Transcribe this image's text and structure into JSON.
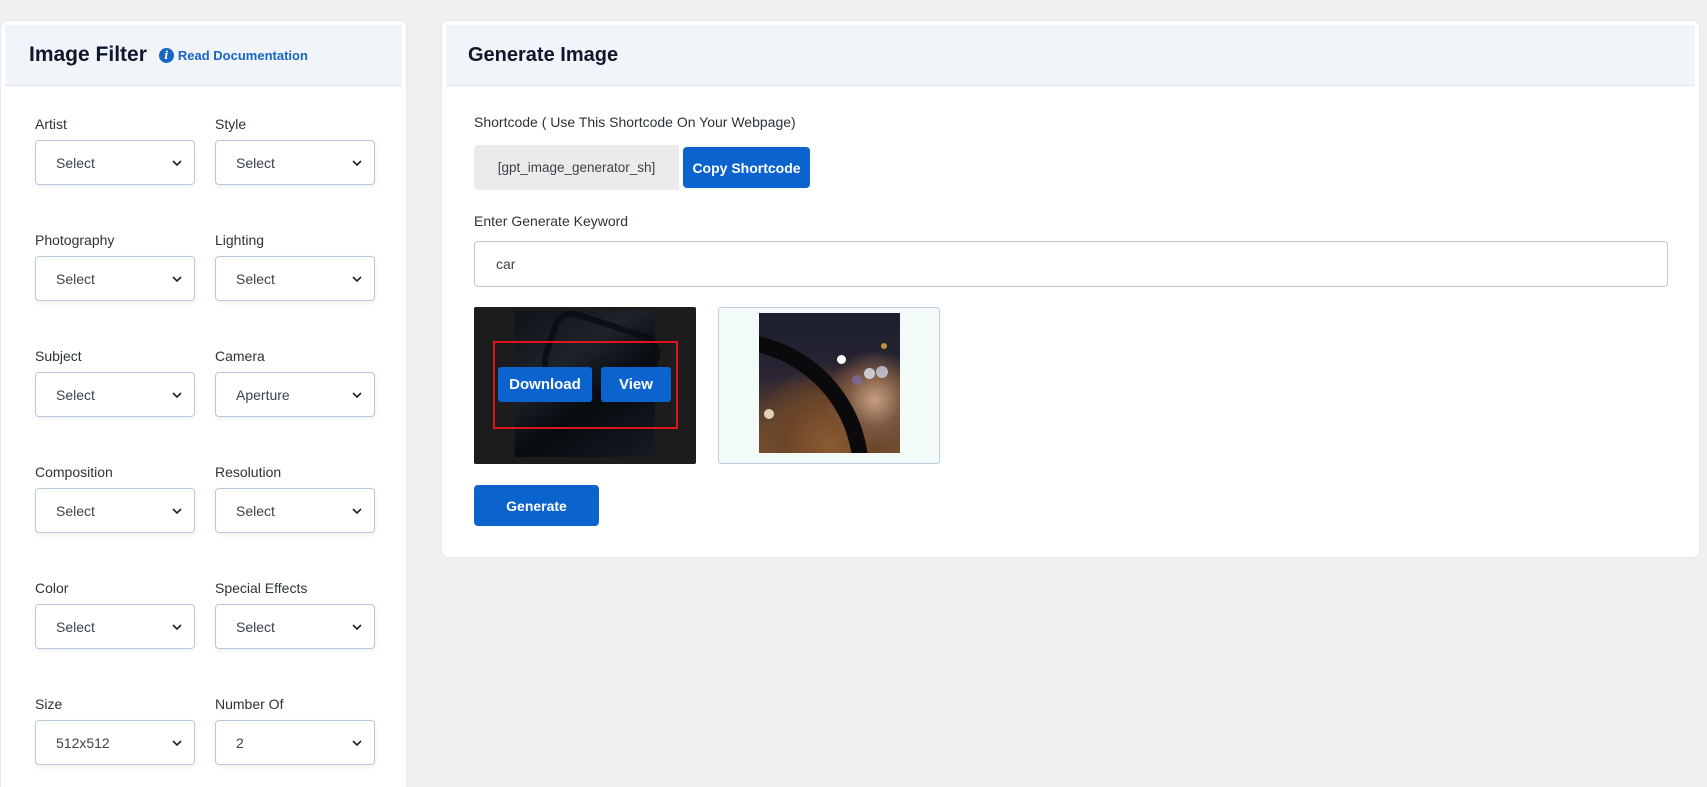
{
  "filter": {
    "title": "Image Filter",
    "doc_link": "Read Documentation",
    "fields": [
      {
        "label": "Artist",
        "value": "Select"
      },
      {
        "label": "Style",
        "value": "Select"
      },
      {
        "label": "Photography",
        "value": "Select"
      },
      {
        "label": "Lighting",
        "value": "Select"
      },
      {
        "label": "Subject",
        "value": "Select"
      },
      {
        "label": "Camera",
        "value": "Aperture"
      },
      {
        "label": "Composition",
        "value": "Select"
      },
      {
        "label": "Resolution",
        "value": "Select"
      },
      {
        "label": "Color",
        "value": "Select"
      },
      {
        "label": "Special Effects",
        "value": "Select"
      },
      {
        "label": "Size",
        "value": "512x512"
      },
      {
        "label": "Number Of",
        "value": "2"
      }
    ]
  },
  "generate": {
    "title": "Generate Image",
    "shortcode_label": "Shortcode ( Use This Shortcode On Your Webpage)",
    "shortcode_value": "[gpt_image_generator_sh]",
    "copy_button": "Copy Shortcode",
    "keyword_label": "Enter Generate Keyword",
    "keyword_value": "car",
    "download_button": "Download",
    "view_button": "View",
    "generate_button": "Generate"
  },
  "colors": {
    "accent": "#0b63ce",
    "highlight": "#e0141e",
    "header_bg": "#f1f5fa"
  },
  "icons": [
    "info-icon",
    "chevron-down-icon"
  ]
}
